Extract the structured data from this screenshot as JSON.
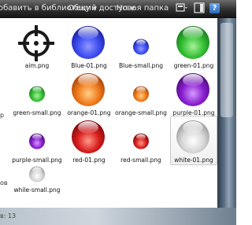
{
  "toolbar": {
    "add_to_library": "обавить в библиотеку",
    "share": "Общий доступ",
    "new_folder": "Новая папка"
  },
  "sidebar": {
    "frag_1": "р",
    "frag_2": "ов"
  },
  "files": [
    {
      "name": "aim.png",
      "icon": "crosshair-icon"
    },
    {
      "name": "Blue-01.png",
      "color": "#3d4df0"
    },
    {
      "name": "Blue-small.png",
      "color": "#4a55ee"
    },
    {
      "name": "green-01.png",
      "color": "#35c035"
    },
    {
      "name": "green-small.png",
      "color": "#3cb83c"
    },
    {
      "name": "orange-01.png",
      "color": "#f07a1a"
    },
    {
      "name": "orange-small.png",
      "color": "#f28020"
    },
    {
      "name": "purple-01.png",
      "color": "#8a1fd0"
    },
    {
      "name": "purple-small.png",
      "color": "#8a22cc"
    },
    {
      "name": "red-01.png",
      "color": "#d81d1d"
    },
    {
      "name": "red-small.png",
      "color": "#d62424"
    },
    {
      "name": "white-01.png",
      "color": "#d8d8d8"
    },
    {
      "name": "while-small.png",
      "color": "#d5d5d5"
    }
  ],
  "status": {
    "text": "в: 13"
  }
}
